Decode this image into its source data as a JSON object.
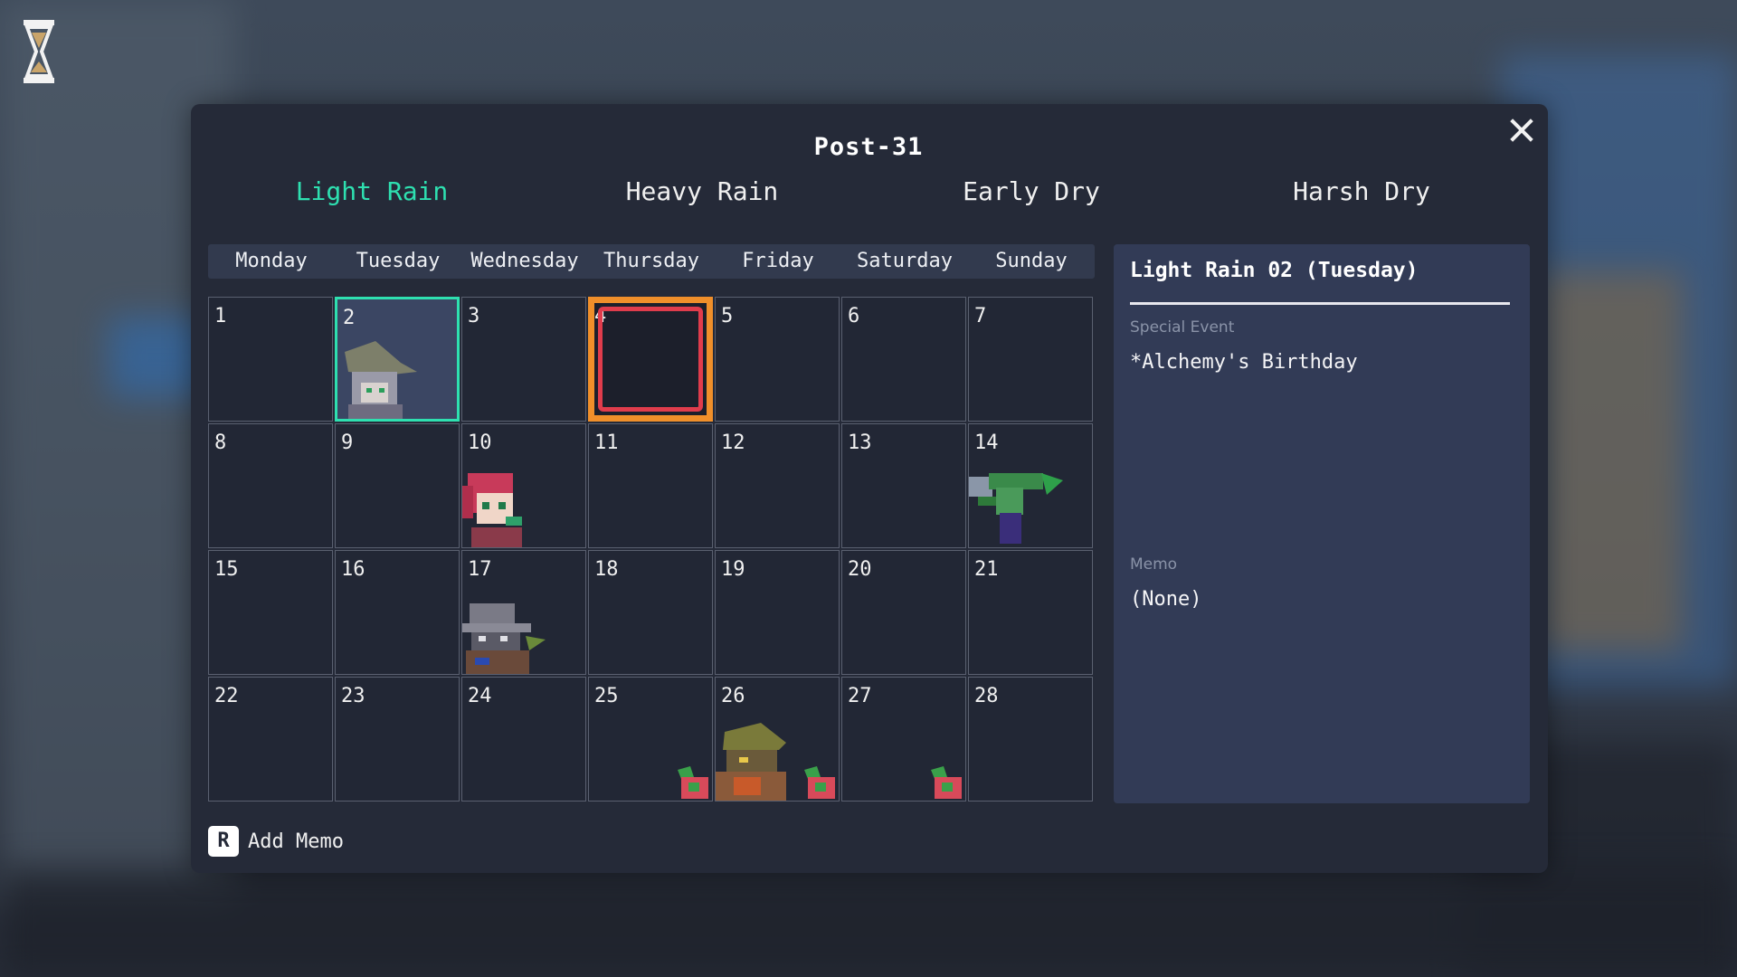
{
  "calendar": {
    "title": "Post-31",
    "seasons": [
      {
        "label": "Light Rain",
        "active": true
      },
      {
        "label": "Heavy Rain",
        "active": false
      },
      {
        "label": "Early Dry",
        "active": false
      },
      {
        "label": "Harsh Dry",
        "active": false
      }
    ],
    "weekdays": [
      "Monday",
      "Tuesday",
      "Wednesday",
      "Thursday",
      "Friday",
      "Saturday",
      "Sunday"
    ],
    "days": [
      "1",
      "2",
      "3",
      "4",
      "5",
      "6",
      "7",
      "8",
      "9",
      "10",
      "11",
      "12",
      "13",
      "14",
      "15",
      "16",
      "17",
      "18",
      "19",
      "20",
      "21",
      "22",
      "23",
      "24",
      "25",
      "26",
      "27",
      "28"
    ],
    "selected_day": 2,
    "today": 4
  },
  "details": {
    "heading": "Light Rain 02 (Tuesday)",
    "special_event_label": "Special Event",
    "special_event_value": "*Alchemy's Birthday",
    "memo_label": "Memo",
    "memo_value": "(None)"
  },
  "footer": {
    "key": "R",
    "add_memo_label": "Add Memo"
  },
  "colors": {
    "accent": "#2ee0b0",
    "panel": "#252a38",
    "today_outer": "#f08f2a",
    "today_inner": "#e03c4c"
  }
}
